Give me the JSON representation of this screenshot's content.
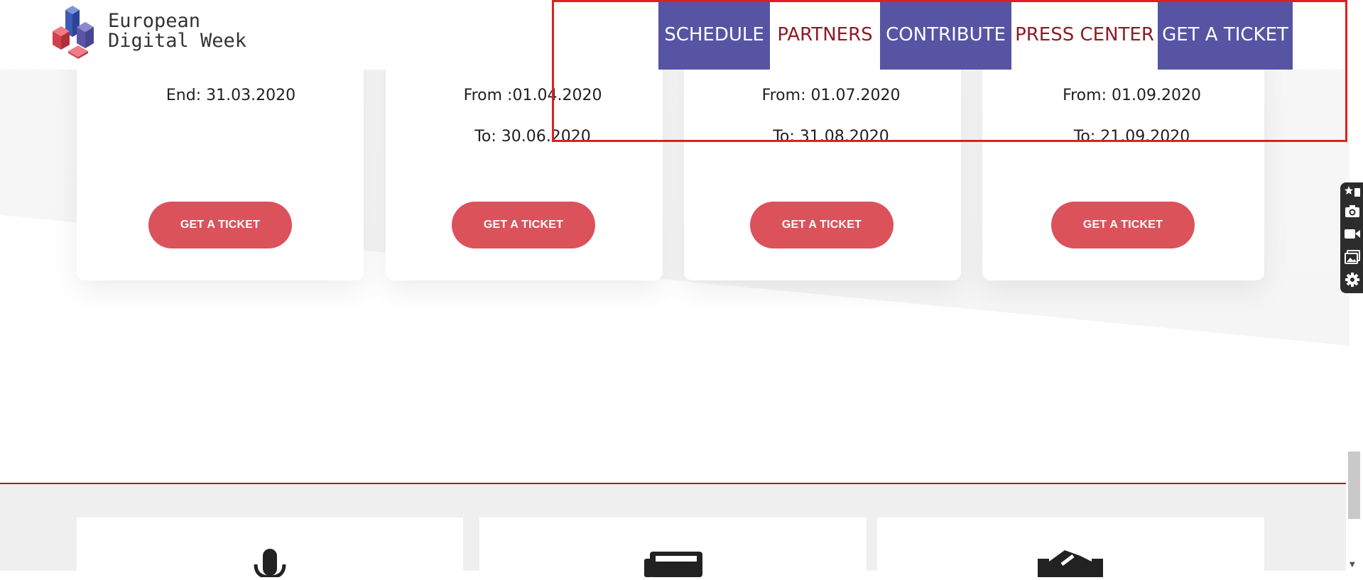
{
  "header": {
    "logo": {
      "line1": "European",
      "line2": "Digital Week"
    },
    "nav": [
      {
        "label": "SCHEDULE",
        "style": "filled"
      },
      {
        "label": "PARTNERS",
        "style": "plain"
      },
      {
        "label": "CONTRIBUTE",
        "style": "filled"
      },
      {
        "label": "PRESS CENTER",
        "style": "plain"
      },
      {
        "label": "GET A TICKET",
        "style": "filled"
      }
    ]
  },
  "pricing": {
    "cards": [
      {
        "lines": [
          "End: 31.03.2020"
        ],
        "button": "GET A TICKET"
      },
      {
        "lines": [
          "From :01.04.2020",
          "To: 30.06.2020"
        ],
        "button": "GET A TICKET"
      },
      {
        "lines": [
          "From: 01.07.2020",
          "To: 31.08.2020"
        ],
        "button": "GET A TICKET"
      },
      {
        "lines": [
          "From: 01.09.2020",
          "To: 21.09.2020"
        ],
        "button": "GET A TICKET"
      }
    ]
  },
  "features": {
    "icons": [
      "microphone-icon",
      "newspaper-icon",
      "handshake-icon"
    ]
  },
  "toolbar": {
    "icons": [
      "bookmark-star-icon",
      "camera-icon",
      "video-icon",
      "gallery-icon",
      "gear-icon"
    ]
  },
  "colors": {
    "nav_filled_bg": "#5654a3",
    "nav_plain_text": "#8e1b26",
    "button_bg": "#db525b",
    "footer_rule": "#a61c2a",
    "highlight_box": "#e02020"
  }
}
